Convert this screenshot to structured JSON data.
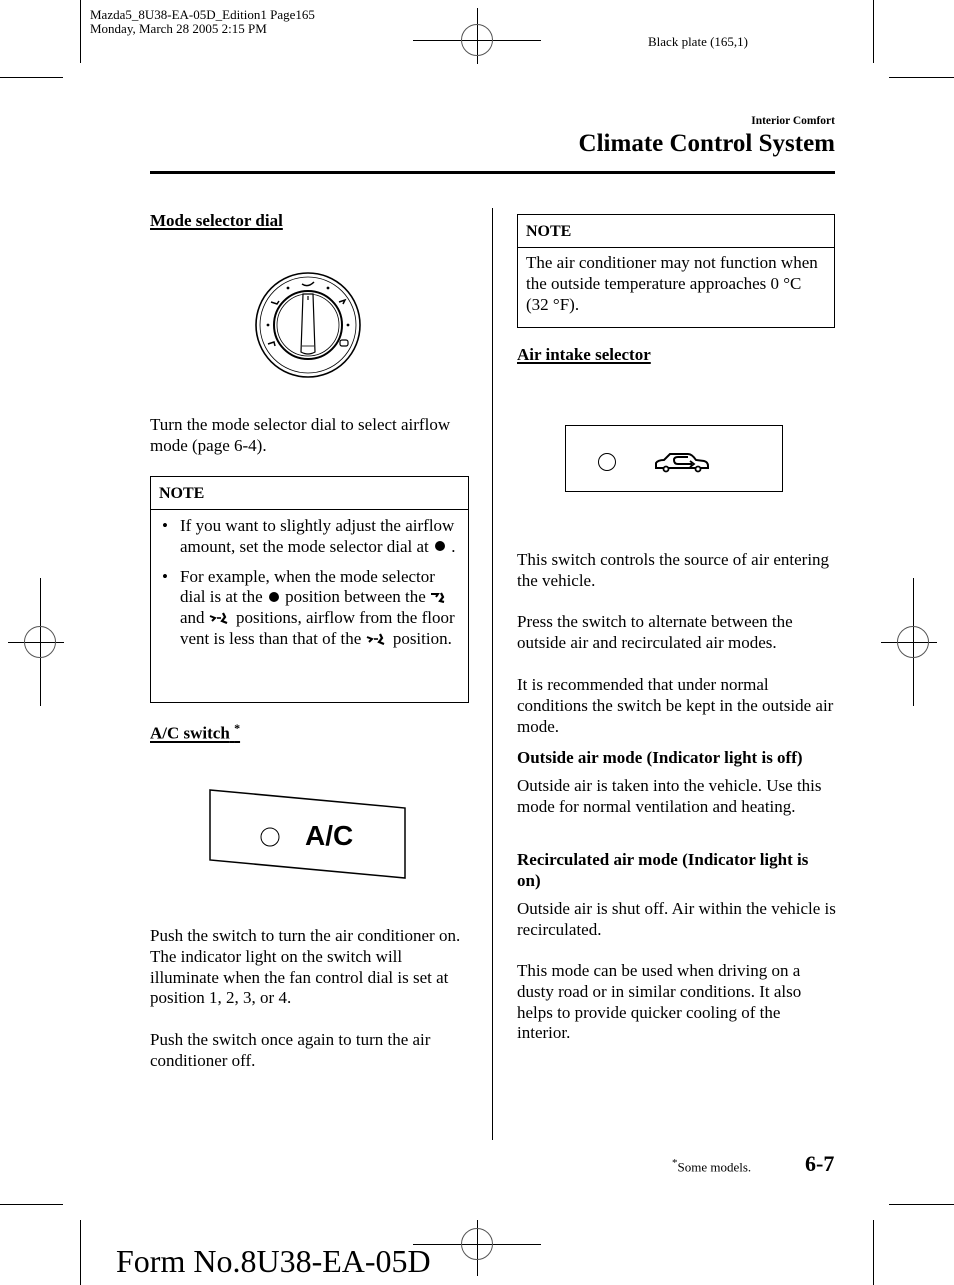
{
  "print_meta": {
    "line1": "Mazda5_8U38-EA-05D_Edition1 Page165",
    "line2": "Monday, March 28 2005 2:15 PM",
    "plate": "Black plate (165,1)"
  },
  "header": {
    "section": "Interior Comfort",
    "title": "Climate Control System"
  },
  "left_column": {
    "mode_selector": {
      "heading": "Mode selector dial",
      "figure_icon": "mode-selector-dial-illustration",
      "text": "Turn the mode selector dial to select airflow mode  (page 6-4).",
      "note": {
        "title": "NOTE",
        "bullet": "•",
        "item1_text": "If you want to slightly adjust the airflow amount, set the mode selector dial at",
        "item1_end": ".",
        "item2_part1": "For example, when the mode selector dial is at the",
        "item2_part2": "position between the",
        "item2_part3": "and",
        "item2_part4": "positions, airflow from the floor vent is less than that of the",
        "item2_part5": "position."
      }
    },
    "ac_switch": {
      "heading": "A/C switch",
      "asterisk": "*",
      "switch_label": "A/C",
      "para1": "Push the switch to turn the air conditioner on. The indicator light on the switch will illuminate when the fan control dial is set at position 1, 2, 3, or 4.",
      "para2": "Push the switch once again to turn the air conditioner off."
    }
  },
  "right_column": {
    "note": {
      "title": "NOTE",
      "text": "The air conditioner may not function when the outside temperature approaches 0 °C (32 °F)."
    },
    "air_intake": {
      "heading": "Air intake selector",
      "switch_icon": "recirculation-car-icon",
      "para1": "This switch controls the source of air entering the vehicle.",
      "para2": "Press the switch to alternate between the outside air and recirculated air modes.",
      "para3": "It is recommended that under normal conditions the switch be kept in the outside air mode.",
      "outside_heading": "Outside air mode (Indicator light is off)",
      "outside_text": "Outside air is taken into the vehicle. Use this mode for normal ventilation and heating.",
      "recirc_heading": "Recirculated air mode (Indicator light is on)",
      "recirc_text": "Outside air is shut off. Air within the vehicle is recirculated.",
      "recirc_text2": "This mode can be used when driving on a dusty road or in similar conditions. It also helps to provide quicker cooling of the interior."
    }
  },
  "footer": {
    "asterisk": "*",
    "footnote": "Some models.",
    "page_number": "6-7",
    "form_number": "Form No.8U38-EA-05D"
  }
}
